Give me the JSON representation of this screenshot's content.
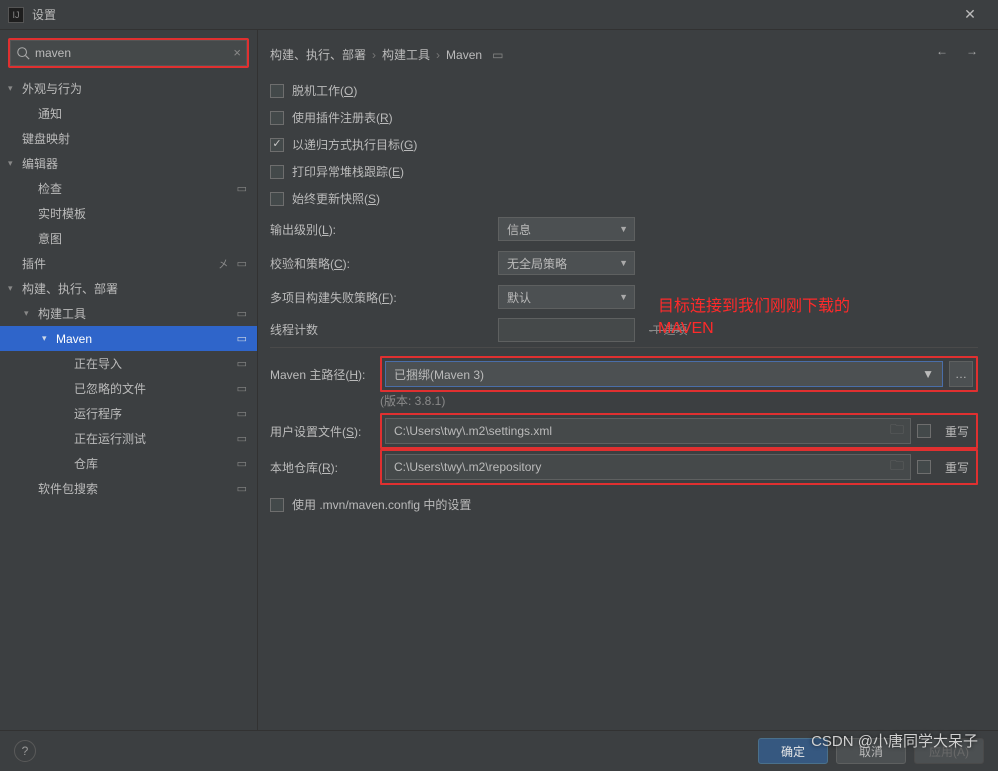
{
  "window": {
    "title": "设置"
  },
  "search": {
    "value": "maven"
  },
  "tree": {
    "appearance": "外观与行为",
    "notifications": "通知",
    "keymap": "键盘映射",
    "editor": "编辑器",
    "inspections": "检查",
    "live_templates": "实时模板",
    "intentions": "意图",
    "plugins": "插件",
    "build": "构建、执行、部署",
    "build_tools": "构建工具",
    "maven": "Maven",
    "importing": "正在导入",
    "ignored": "已忽略的文件",
    "runner": "运行程序",
    "running_tests": "正在运行测试",
    "repositories": "仓库",
    "package_search": "软件包搜索"
  },
  "breadcrumb": {
    "p1": "构建、执行、部署",
    "p2": "构建工具",
    "p3": "Maven",
    "project_icon_title": "当前项目"
  },
  "options": {
    "offline": {
      "pre": "脱机工作(",
      "key": "O",
      "post": ")"
    },
    "plugin_registry": {
      "pre": "使用插件注册表(",
      "key": "R",
      "post": ")"
    },
    "recursive": {
      "pre": "以递归方式执行目标(",
      "key": "G",
      "post": ")"
    },
    "stacktraces": {
      "pre": "打印异常堆栈跟踪(",
      "key": "E",
      "post": ")"
    },
    "snapshots": {
      "pre": "始终更新快照(",
      "key": "S",
      "post": ")"
    }
  },
  "output_level": {
    "label_pre": "输出级别(",
    "label_key": "L",
    "label_post": "):",
    "value": "信息"
  },
  "checksum": {
    "label_pre": "校验和策略(",
    "label_key": "C",
    "label_post": "):",
    "value": "无全局策略"
  },
  "fail_policy": {
    "label_pre": "多项目构建失败策略(",
    "label_key": "F",
    "label_post": "):",
    "value": "默认"
  },
  "thread_count": {
    "label": "线程计数",
    "option_suffix": "-T 选项"
  },
  "home": {
    "label_pre": "Maven 主路径(",
    "label_key": "H",
    "label_post": "):",
    "value": "已捆绑(Maven 3)",
    "version": "(版本: 3.8.1)"
  },
  "user_settings": {
    "label_pre": "用户设置文件(",
    "label_key": "S",
    "label_post": "):",
    "value": "C:\\Users\\twy\\.m2\\settings.xml",
    "override": "重写"
  },
  "local_repo": {
    "label_pre": "本地仓库(",
    "label_key": "R",
    "label_post": "):",
    "value": "C:\\Users\\twy\\.m2\\repository",
    "override": "重写"
  },
  "use_config": "使用 .mvn/maven.config 中的设置",
  "annotation": {
    "line1": "目标连接到我们刚刚下载的",
    "line2": "MAVEN"
  },
  "footer": {
    "ok": "确定",
    "cancel": "取消",
    "apply": "应用(A)"
  },
  "watermark": "CSDN @小唐同学大呆子"
}
